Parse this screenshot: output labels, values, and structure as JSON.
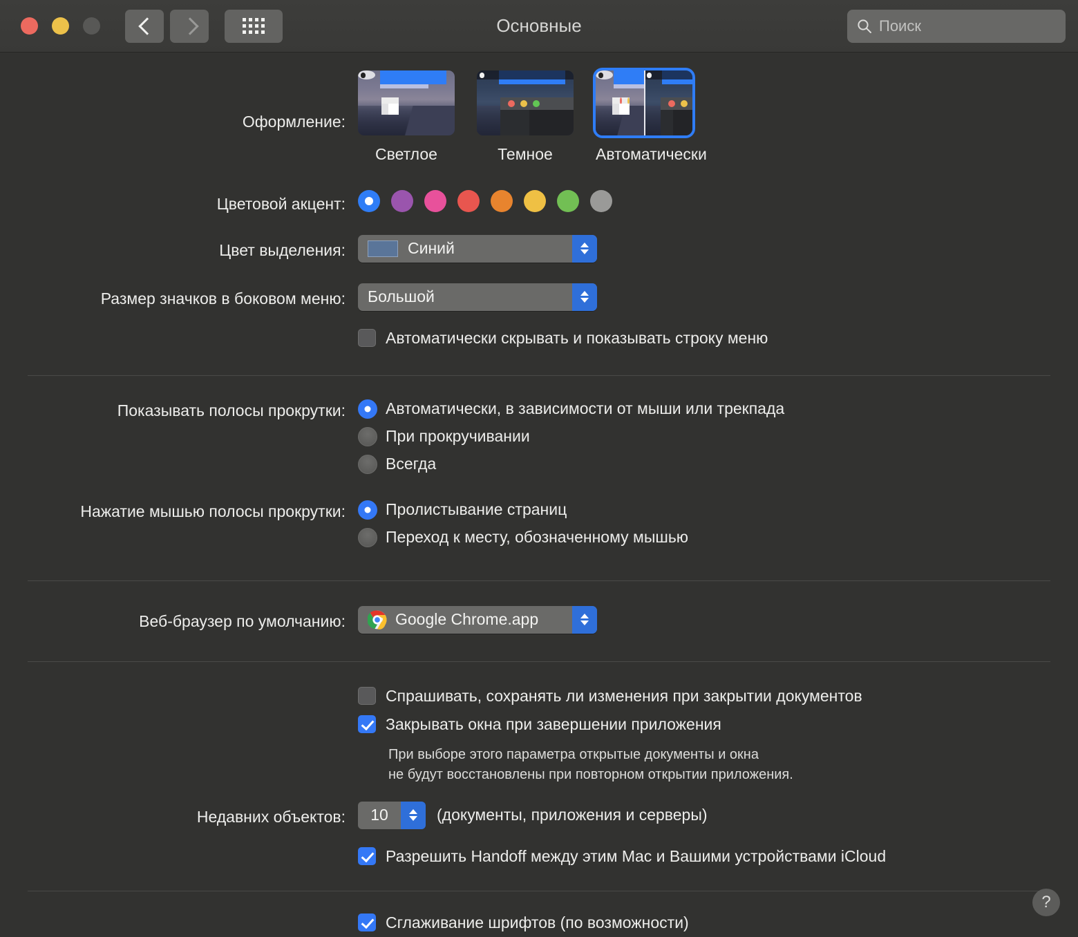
{
  "window": {
    "title": "Основные",
    "traffic_lights": [
      "close",
      "minimize",
      "zoom"
    ],
    "colors": {
      "background": "#323230",
      "titlebar": "#3b3b39",
      "accent_blue": "#3478f6",
      "control": "#6a6a68"
    }
  },
  "toolbar": {
    "back_icon": "chevron-left-icon",
    "forward_icon": "chevron-right-icon",
    "grid_icon": "show-all-icon"
  },
  "search": {
    "placeholder": "Поиск",
    "value": "",
    "icon": "search-icon"
  },
  "appearance": {
    "label": "Оформление:",
    "options": [
      {
        "id": "light",
        "label": "Светлое",
        "selected": false
      },
      {
        "id": "dark",
        "label": "Темное",
        "selected": false
      },
      {
        "id": "auto",
        "label": "Автоматически",
        "selected": true
      }
    ]
  },
  "accent": {
    "label": "Цветовой акцент:",
    "swatches": [
      {
        "name": "blue",
        "color": "#2f7df6",
        "selected": true
      },
      {
        "name": "purple",
        "color": "#9a55ad",
        "selected": false
      },
      {
        "name": "pink",
        "color": "#e8519b",
        "selected": false
      },
      {
        "name": "red",
        "color": "#e8564f",
        "selected": false
      },
      {
        "name": "orange",
        "color": "#e8842e",
        "selected": false
      },
      {
        "name": "yellow",
        "color": "#efc044",
        "selected": false
      },
      {
        "name": "green",
        "color": "#72bf54",
        "selected": false
      },
      {
        "name": "graphite",
        "color": "#9a9a98",
        "selected": false
      }
    ]
  },
  "highlight_color": {
    "label": "Цвет выделения:",
    "value": "Синий",
    "swatch_color": "#5a7599"
  },
  "sidebar_icon_size": {
    "label": "Размер значков в боковом меню:",
    "value": "Большой"
  },
  "auto_hide_menubar": {
    "label": "Автоматически скрывать и показывать строку меню",
    "checked": false
  },
  "show_scrollbars": {
    "label": "Показывать полосы прокрутки:",
    "options": [
      {
        "label": "Автоматически, в зависимости от мыши или трекпада",
        "selected": true
      },
      {
        "label": "При прокручивании",
        "selected": false
      },
      {
        "label": "Всегда",
        "selected": false
      }
    ]
  },
  "scrollbar_click": {
    "label": "Нажатие мышью полосы прокрутки:",
    "options": [
      {
        "label": "Пролистывание страниц",
        "selected": true
      },
      {
        "label": "Переход к месту, обозначенному мышью",
        "selected": false
      }
    ]
  },
  "default_browser": {
    "label": "Веб-браузер по умолчанию:",
    "value": "Google Chrome.app",
    "icon": "chrome-icon"
  },
  "documents": {
    "ask_save": {
      "label": "Спрашивать, сохранять ли изменения при закрытии документов",
      "checked": false
    },
    "close_windows": {
      "label": "Закрывать окна при завершении приложения",
      "checked": true
    },
    "help_line_1": "При выборе этого параметра открытые документы и окна",
    "help_line_2": "не будут восстановлены при повторном открытии приложения."
  },
  "recent_items": {
    "label": "Недавних объектов:",
    "value": "10",
    "suffix": "(документы, приложения и серверы)"
  },
  "handoff": {
    "label": "Разрешить Handoff между этим Mac и Вашими устройствами iCloud",
    "checked": true
  },
  "font_smoothing": {
    "label": "Сглаживание шрифтов (по возможности)",
    "checked": true
  },
  "help_button": {
    "label": "?",
    "icon": "question-mark-icon"
  }
}
